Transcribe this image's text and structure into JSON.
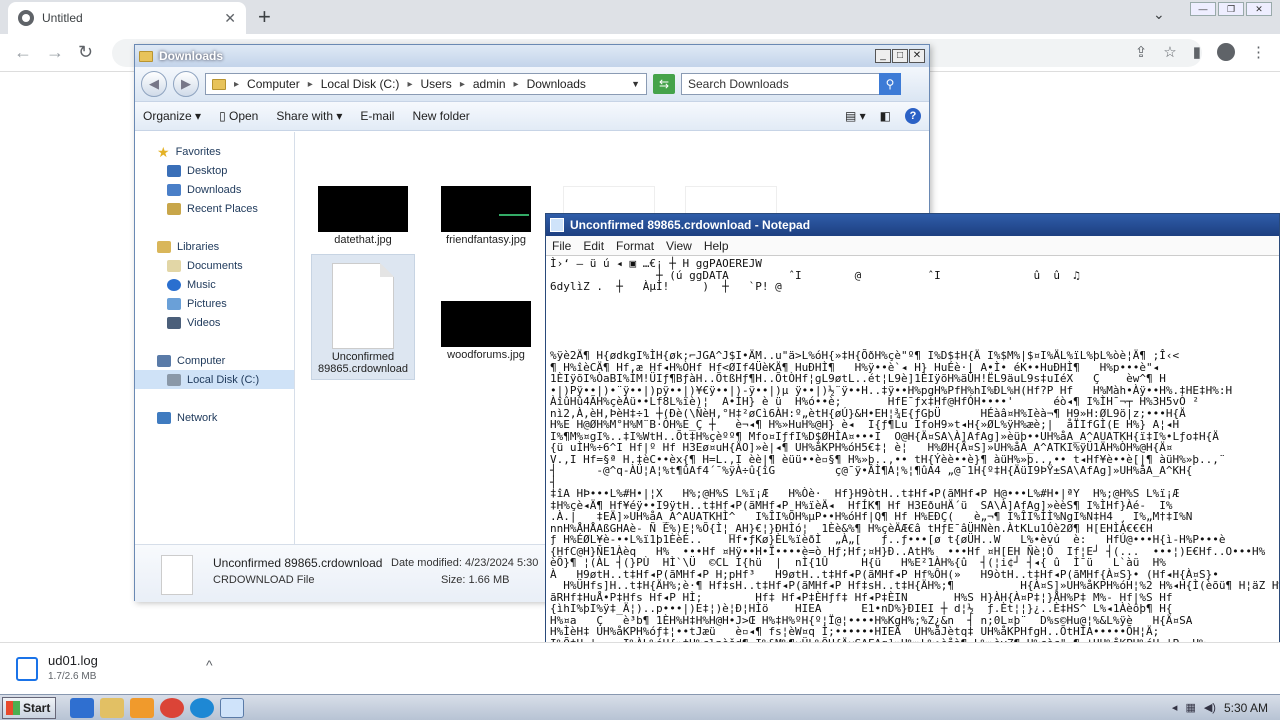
{
  "browser": {
    "tab_title": "Untitled",
    "tab_close": "✕",
    "new_tab": "+",
    "tabs_menu": "⌄",
    "window_controls": [
      "—",
      "❐",
      "✕"
    ]
  },
  "explorer": {
    "title": "Downloads",
    "controls": [
      "_",
      "□",
      "✕"
    ],
    "breadcrumb": [
      "Computer",
      "Local Disk (C:)",
      "Users",
      "admin",
      "Downloads"
    ],
    "search_placeholder": "Search Downloads",
    "commands": {
      "organize": "Organize",
      "open": "Open",
      "share_with": "Share with",
      "email": "E-mail",
      "new_folder": "New folder"
    },
    "nav": {
      "favorites": "Favorites",
      "desktop": "Desktop",
      "downloads": "Downloads",
      "recent_places": "Recent Places",
      "libraries": "Libraries",
      "documents": "Documents",
      "music": "Music",
      "pictures": "Pictures",
      "videos": "Videos",
      "computer": "Computer",
      "local_disk": "Local Disk (C:)",
      "network": "Network"
    },
    "files": {
      "f1": "datethat.jpg",
      "f2": "friendfantasy.jpg",
      "f3": "Unconfirmed 89865.crdownload",
      "f4": "woodforums.jpg"
    },
    "details": {
      "name": "Unconfirmed 89865.crdownload",
      "type": "CRDOWNLOAD File",
      "modified": "Date modified: 4/23/2024 5:30",
      "size": "Size: 1.66 MB"
    }
  },
  "notepad": {
    "title": "Unconfirmed 89865.crdownload - Notepad",
    "menu": [
      "File",
      "Edit",
      "Format",
      "View",
      "Help"
    ],
    "content": "Ì›‘ – ü ú ◂ ▣ …€¡ ┼ H ggPAOEREJW\n                ┼ (ú ggDATA         ˆI        @          ˆI              û  û  ♫\n6dylìZ .  ┼   ÀµÌ!     )  ┼   `P! @\n\n\n\n\n\n%ÿè2Ä¶ H{ødkgI%ÌH{øk;⌐JGA^J$I•ÄM..u\"ä>L%óH{»‡H{ÕðH%çè\"º¶ I%D$‡H{Ä I%$M%|$¤I%ÄL%ïL%þL%òè¦Ä¶ ;Î‹<\n¶ H%îèCÄ¶ Hf,æ Hf◂H%ÒHf Hf<ØIf4ÜèKÄ¶ HuÐHÌ¶   H%ÿ••è`◂ H} HuÉè·| A•Ì• éK••HuÐHÌ¶   H%p•••è\"◂\n1ÈIÿõI%ÒaBI%ÌM!ÜIƒ¶BƒàH..ÕtßHƒ¶H..ÕtÒHf¦gL9øtL..ét¦L9è]1ÈIÿõH%äÜH!ËL9äuL9s‡uIéX   Ç    èw^¶ H\n•|)Pÿ••|)•¨ÿ••|)pÿ••|)¥€ÿ••|)-ÿ••|)µ ÿ••|)½¨ÿ••H..‡ÿ••H%pgH%PfH%hI%ÐL%H(Hf?P Hf   H%Màh•Àÿ••H%.‡HE‡H%:H\nÀîûHû4ÃH%çèÀü••Lf8L%ïè)¦  A•ÌH} è ü  H%ó••è;       HfE¯ƒx‡Hf@HfÓH••••'      éò◂¶ I%ÌH¯¬┬ H%3H5vÒ ²  \nnì2,À,èH,ÞèH‡÷1 ┼(Ðè(\\ÑèH,°H‡²øCì6ÀH:º„ètH{øÚ}&H•EH¦¾E{ƒGþÜ      HÉàâ¤H%Ièà¬¶ H9»H:ØL9ö|z;•••H{Ä\nH%E H@ØH%M°H%M¨B·ÒH%E_Ç ┼   è¬◂¶ H%»HuH%@H} è◂  I{ƒ¶Lu IfoH9»t◂H{»ØL%ÿH%æè;|  åÏIfGÌ(E H%} A¦◂H\nI%¶M%¤gI%..‡I%WtH..Õt‡H%çèºº¶ Mfo¤IƒfI%D$ØHÌA¤•••I  O@H{Ä¤SA\\À]AfAg]»èüþ••UH%åA_A^AUATKH{ï‡I%•Lƒo‡H{Ä\n{ü uÌH%÷6^I Hf|º Hf H3Eø¤uH{ÄO]»è|◂¶ UH%åKPH%óH5€‡¦ è¦   H%ØH{Ä¤S]»UH%åA_A^ATKI%ÿÜ1ÄH%ÒH%@H{Ä¤\nV.,I Hf=§ª H.‡èC••èx{¶ H=L.,I èè|¶ èüü••è▫§¶ H%»þ..,•• tH{Ýèè••è}¶ àüH%»þ..,•• t◂Hf¥è••è[|¶ àüH%»þ..,¨\n┤      -@^q-ÀÜ¦A¦%t¶ûAf4´¯%ÿÀ÷û{îG         ç@¯ÿ•ÂÌ¶A¦%¦¶ûA4 „@¯1H{º‡H{ÄüI9ÞŸ±SA\\AfAg]»UH%åA_A^KH{\n┤                                                                  \n‡îA HÞ•••L%#H•|¦X   H%;@H%S L%ï¡Æ   H%Òè·  Hf}H9òtH..t‡Hf◂P(ãMHf◂P H@•••L%#H•|ªY  H%;@H%S L%ï¡Æ\n‡H%çè◂Ä¶ Hf¥éÿ••I9ÿtH..t‡Hf◂P(ãMHf◂P H%ïèÄ◂  HfÍK¶ Hf H3EðuHÄ´ü  SA\\À]AfAg]»èèS¶ I%ÌHf}Àé-  I%\n.À.|   ‡EÄ]»UH%åA_A^AUATKHÌ^   I%ÎI%ÕH%µP••H%óHf|Q¶ Hf H%EÐÇ(   è„¬¶ I%ÎI%ÌÌ%NgI%N‡H4 ¸ I%„M†‡I%N\nnnH%ÅHÅAßGHAè- Ñ É%)E¦%Õ{Ì¦_AH}€¦}ÐHÌó¦  1Èè&%¶ H%çèÄÆ€â tHƒE¯âÜHNèn.ÀtKLu1Óè2Ø¶ H[EHÌÀ€€€H\nƒ H%ÉØL¥è-••L%ï1þ1ÈèÉ..    Hf•ƒKø}ÈL%ïèðÌ  „À„[   ƒ..ƒ•••[ø t{øÜH..W   L%•èvú  è:   HfÚ@•••H{ì-H%P•••è\n{HfC@H}ÑE1Àèq   H%  •••Hf ¤Hÿ••H•Ï••••è=ò Hƒ;Hf;¤H}Ð..AtH%  •••Hf ¤H[EH Ñè¦Ö  If¦E┘ ┤(...  •••¦)E€Hf..O•••H%\nèÕ}¶ ¦(ÀL ┤(}PÙ  HÌ`\\Ü  ©CL I{hü  |  nÌ{1Û     H{ü   H%E²1ÀH%{û  ┤(¦i¢┘ ┤◂{ û  Ì¯ü   L`àü  H%\nÀ   H9øtH..t‡Hf◂P(ãMHf◂P H;pHf³   H9øtH..t‡Hf◂P(ãMHf◂P Hf%ÔH(»   H9òtH..t‡Hf◂P(ãMHf{À¤S}• (Hf◂H{À¤S}•\n  H%ÜHfs]H..t‡H{ÄH%;è·¶ Hf‡sH..t‡Hf◂P(ãMHf◂P Hf‡sH..t‡H{ÄH%;¶          H{À¤S]»UH%åKPH%óH¦%2 H%◂H{Ì(èõü¶ H¦äZ H%4H%Ühfs H..t‡HfH%.\nãRHf‡HuÅ•P‡Hfs Hf◂P HÌ;        Hf‡ Hf◂P‡ÈHƒf‡ Hf◂P‡ÈIN       H%S H}ÀH{À¤P‡¦}ÅH%P‡ M%- Hf|%S Hf\n{ìhI%þI%ÿ‡_Ä¦)..p•••|)E‡¦)è¦Ð¦HÌö    HIEA      E1•nD%}ÐIEI ┼ d¦½  ƒ.Èt¦¦}¿..È‡HS^ L%◂1Àèôþ¶ H{\nH%¤a   Ç   è³b¶ 1ÈH%H‡H%H@H•J>Œ H%‡H%ºH{º¦Ï@¦••••H%KgH%;%Z¿&n  ┤ n;0L¤þ¨  D%s©Hu@¦%&L%ÿè   H{Ä¤SA\nH%ÌèH‡ UH%åKPH%óƒ‡¦••tJæü   è▫◂¶ fs¦èW¤q Ì;••••••HIEÄ  UH%åJètq‡ UH%åKPHfgH..ÕtHÌA•••••ÕH¦Ä;\nI%Õ‡H·|-…  I%ÀL%óH{»‡H%çlpèšd¶ I%&M%¶¤ÜL%ÕH{Ä¤SAFAg]»H%»L%•èåà¶ L%»èyZ¶ H%çèç\"◂¶ ¦UH%åKPH%óH·|P„ H%\n|]¶ Hf³„   H..‡tH%ªÄ   è¥f¶ Lk!H³¯   èÒà••HSHèÏ]¶ L%ÿèEà••H{»óH%çè\"f¶ H[Ä¦SAf]»ãü‡äüä H%Ìè¿‡ I%ÌH"
  },
  "download": {
    "name": "ud01.log",
    "size": "1.7/2.6 MB",
    "chevron": "^"
  },
  "taskbar": {
    "start": "Start",
    "time": "5:30 AM"
  },
  "colors": {
    "explorer_border": "#6a89b3",
    "notepad_title": "#2f5da9",
    "selection": "#cfe2f7"
  }
}
